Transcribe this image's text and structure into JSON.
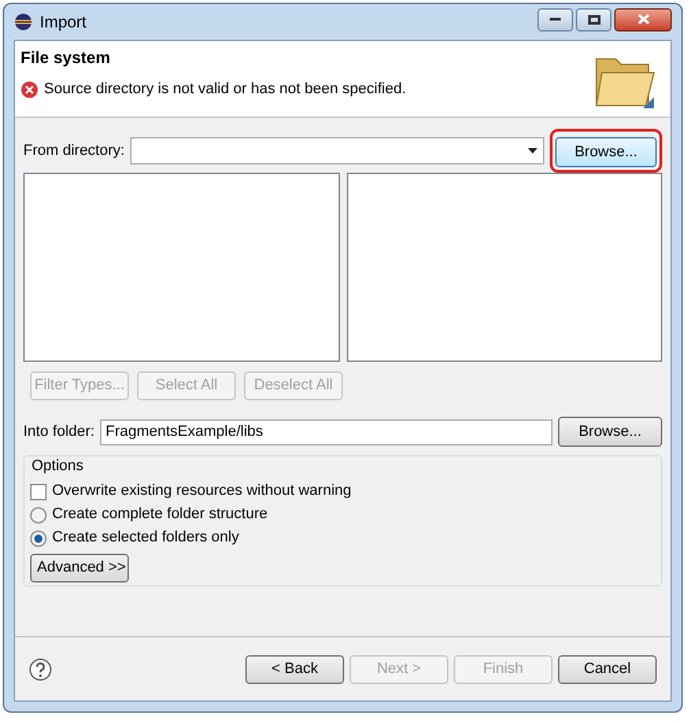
{
  "window": {
    "title": "Import"
  },
  "header": {
    "title": "File system",
    "message": "Source directory is not valid or has not been specified."
  },
  "from_directory": {
    "label": "From directory:",
    "browse": {
      "label": "Browse...",
      "highlighted": true
    }
  },
  "list_buttons": [
    {
      "label": "Filter Types...",
      "disabled": true
    },
    {
      "label": "Select All",
      "disabled": true
    },
    {
      "label": "Deselect All",
      "disabled": true
    }
  ],
  "into_folder": {
    "label": "Into folder:",
    "value": "FragmentsExample/libs",
    "browse": {
      "label": "Browse...",
      "highlighted": false
    }
  },
  "options": {
    "title": "Options",
    "items": [
      {
        "kind": "checkbox",
        "label": "Overwrite existing resources without warning",
        "checked": false
      },
      {
        "kind": "radio",
        "label": "Create complete folder structure",
        "selected": false
      },
      {
        "kind": "radio",
        "label": "Create selected folders only",
        "selected": true
      }
    ],
    "advanced": "Advanced >>"
  },
  "footer": {
    "buttons": [
      {
        "label": "< Back",
        "disabled": false
      },
      {
        "label": "Next >",
        "disabled": true
      },
      {
        "label": "Finish",
        "disabled": true
      },
      {
        "label": "Cancel",
        "disabled": false
      }
    ]
  }
}
